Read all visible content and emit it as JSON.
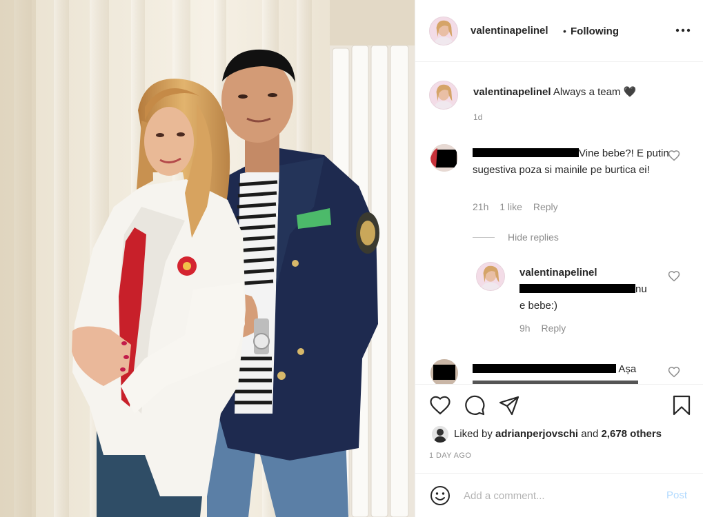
{
  "post": {
    "username": "valentinapelinel",
    "follow_status": "Following",
    "separator": "•",
    "caption": "Always a team",
    "caption_time": "1d"
  },
  "comments": [
    {
      "text": "Vine bebe?! E putin sugestiva poza si mainile pe burtica ei!",
      "time": "21h",
      "likes": "1 like",
      "reply_label": "Reply",
      "hide_replies": "Hide replies",
      "replies": [
        {
          "username": "valentinapelinel",
          "text_line1": "nu",
          "text_line2": "e bebe:)",
          "time": "9h",
          "reply_label": "Reply"
        }
      ]
    },
    {
      "text": "Așa"
    }
  ],
  "likes": {
    "prefix": "Liked by",
    "user": "adrianperjovschi",
    "conjunction": "and",
    "others": "2,678 others"
  },
  "timestamp": "1 DAY AGO",
  "add_comment": {
    "placeholder": "Add a comment...",
    "post_label": "Post"
  },
  "icons": {
    "more": "more-options-icon",
    "like": "heart-icon",
    "comment": "comment-icon",
    "share": "share-icon",
    "save": "bookmark-icon",
    "emoji": "emoji-icon"
  },
  "colors": {
    "text": "#262626",
    "muted": "#8e8e8e",
    "post_disabled": "#b3dbff",
    "divider": "#efefef"
  }
}
